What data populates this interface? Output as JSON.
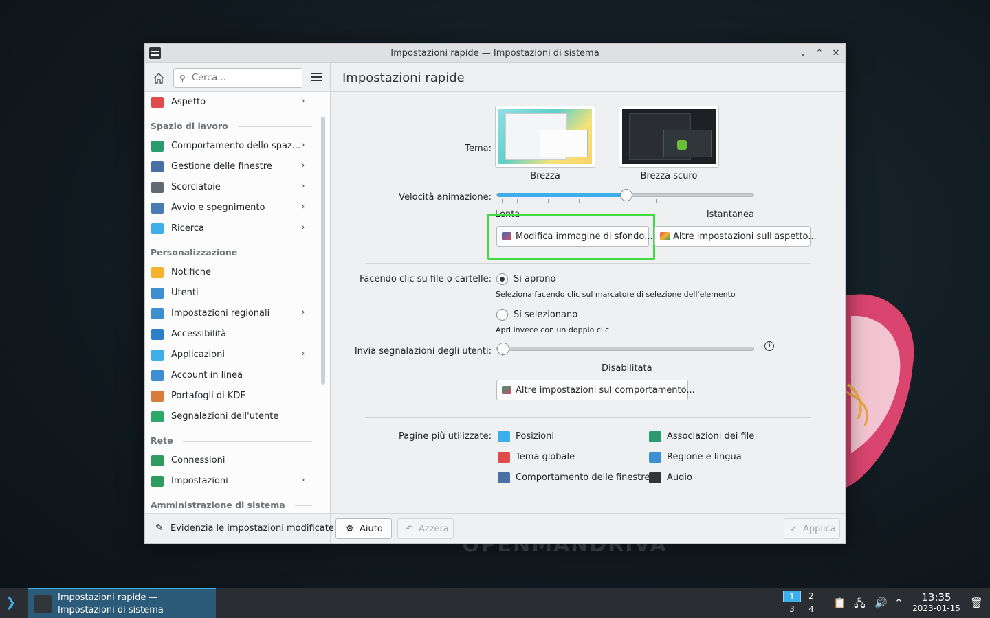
{
  "window": {
    "title": "Impostazioni rapide — Impostazioni di sistema"
  },
  "sidebar": {
    "search_placeholder": "Cerca...",
    "entries": [
      {
        "kind": "item",
        "label": "Aspetto",
        "icon": "appearance-icon",
        "color": "#e04c4c",
        "chevron": true
      },
      {
        "kind": "header",
        "label": "Spazio di lavoro"
      },
      {
        "kind": "item",
        "label": "Comportamento dello spaz...",
        "icon": "workspace-behavior-icon",
        "color": "#2b9a6e",
        "chevron": true
      },
      {
        "kind": "item",
        "label": "Gestione delle finestre",
        "icon": "window-management-icon",
        "color": "#4a6fa5",
        "chevron": true
      },
      {
        "kind": "item",
        "label": "Scorciatoie",
        "icon": "keyboard-icon",
        "color": "#5f6a75",
        "chevron": true
      },
      {
        "kind": "item",
        "label": "Avvio e spegnimento",
        "icon": "startup-icon",
        "color": "#4b7bb3",
        "chevron": true
      },
      {
        "kind": "item",
        "label": "Ricerca",
        "icon": "search-icon",
        "color": "#3daee9",
        "chevron": true
      },
      {
        "kind": "header",
        "label": "Personalizzazione"
      },
      {
        "kind": "item",
        "label": "Notifiche",
        "icon": "bell-icon",
        "color": "#f4b22d",
        "chevron": false
      },
      {
        "kind": "item",
        "label": "Utenti",
        "icon": "user-icon",
        "color": "#3d8fd1",
        "chevron": false
      },
      {
        "kind": "item",
        "label": "Impostazioni regionali",
        "icon": "regional-icon",
        "color": "#3d8fd1",
        "chevron": true
      },
      {
        "kind": "item",
        "label": "Accessibilità",
        "icon": "accessibility-icon",
        "color": "#2c7fc8",
        "chevron": false
      },
      {
        "kind": "item",
        "label": "Applicazioni",
        "icon": "applications-icon",
        "color": "#3daee9",
        "chevron": true
      },
      {
        "kind": "item",
        "label": "Account in linea",
        "icon": "online-accounts-icon",
        "color": "#3d8fd1",
        "chevron": false
      },
      {
        "kind": "item",
        "label": "Portafogli di KDE",
        "icon": "wallet-icon",
        "color": "#d97b3a",
        "chevron": false
      },
      {
        "kind": "item",
        "label": "Segnalazioni dell'utente",
        "icon": "feedback-icon",
        "color": "#2ea86a",
        "chevron": false
      },
      {
        "kind": "header",
        "label": "Rete"
      },
      {
        "kind": "item",
        "label": "Connessioni",
        "icon": "globe-icon",
        "color": "#2f9b5f",
        "chevron": false
      },
      {
        "kind": "item",
        "label": "Impostazioni",
        "icon": "globe-settings-icon",
        "color": "#2f9b5f",
        "chevron": true
      },
      {
        "kind": "header",
        "label": "Amministrazione di sistema"
      }
    ],
    "footer_label": "Evidenzia le impostazioni modificate"
  },
  "content": {
    "title": "Impostazioni rapide",
    "theme_label": "Tema:",
    "themes": [
      {
        "name": "Brezza",
        "selected": true
      },
      {
        "name": "Brezza scuro",
        "selected": false
      }
    ],
    "animation_label": "Velocità animazione:",
    "animation_value": 0.5,
    "animation_min": "Lenta",
    "animation_max": "Istantanea",
    "wallpaper_button": "Modifica immagine di sfondo...",
    "appearance_button": "Altre impostazioni sull'aspetto...",
    "click_label": "Facendo clic su file o cartelle:",
    "click_open": "Si aprono",
    "click_open_hint": "Seleziona facendo clic sul marcatore di selezione dell'elemento",
    "click_select": "Si selezionano",
    "click_select_hint": "Apri invece con un doppio clic",
    "feedback_label": "Invia segnalazioni degli utenti:",
    "feedback_value": 0,
    "feedback_state": "Disabilitata",
    "behavior_button": "Altre impostazioni sul comportamento...",
    "most_used_label": "Pagine più utilizzate:",
    "most_used": [
      {
        "label": "Posizioni",
        "icon": "folder-icon",
        "color": "#3daee9"
      },
      {
        "label": "Associazioni dei file",
        "icon": "file-associations-icon",
        "color": "#2b9a6e"
      },
      {
        "label": "Tema globale",
        "icon": "global-theme-icon",
        "color": "#e04c4c"
      },
      {
        "label": "Regione e lingua",
        "icon": "region-icon",
        "color": "#3d8fd1"
      },
      {
        "label": "Comportamento delle finestre",
        "icon": "window-behavior-icon",
        "color": "#4a6fa5"
      },
      {
        "label": "Audio",
        "icon": "audio-icon",
        "color": "#31363b"
      }
    ],
    "help_button": "Aiuto",
    "reset_button": "Azzera",
    "apply_button": "Applica"
  },
  "wallpaper": {
    "watermark": "OPENMANDRIVA"
  },
  "taskbar": {
    "task_label": "Impostazioni rapide  — Impostazioni di sistema",
    "pager": [
      "1",
      "2",
      "3",
      "4"
    ],
    "active_desktop": "1",
    "time": "13:35",
    "date": "2023-01-15"
  }
}
